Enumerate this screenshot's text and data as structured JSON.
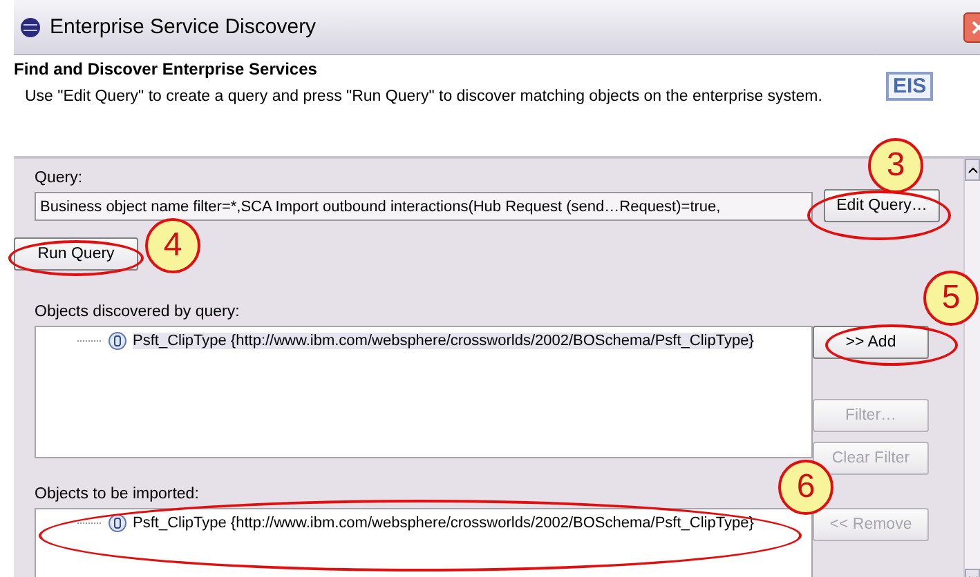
{
  "window": {
    "title": "Enterprise Service Discovery"
  },
  "header": {
    "title": "Find and Discover Enterprise Services",
    "description": "Use \"Edit Query\" to create a query and press \"Run Query\" to discover matching objects on the enterprise system.",
    "logo_text": "EIS"
  },
  "query": {
    "label": "Query:",
    "value": "Business object name filter=*,SCA Import outbound interactions(Hub Request (send…Request)=true,",
    "edit_button": "Edit Query…",
    "run_button": "Run Query"
  },
  "discovered": {
    "label": "Objects discovered by query:",
    "items": [
      {
        "text": "Psft_ClipType {http://www.ibm.com/websphere/crossworlds/2002/BOSchema/Psft_ClipType}",
        "selected": true
      }
    ]
  },
  "side_buttons": [
    {
      "label": ">> Add",
      "disabled": false
    },
    {
      "label": "Filter…",
      "disabled": true
    },
    {
      "label": "Clear Filter",
      "disabled": true
    }
  ],
  "imported": {
    "label": "Objects to be imported:",
    "items": [
      {
        "text": "Psft_ClipType {http://www.ibm.com/websphere/crossworlds/2002/BOSchema/Psft_ClipType}",
        "selected": false
      }
    ],
    "remove_button": {
      "label": "<< Remove",
      "disabled": true
    }
  },
  "callouts": [
    {
      "label": "3"
    },
    {
      "label": "4"
    },
    {
      "label": "5"
    },
    {
      "label": "6"
    }
  ]
}
